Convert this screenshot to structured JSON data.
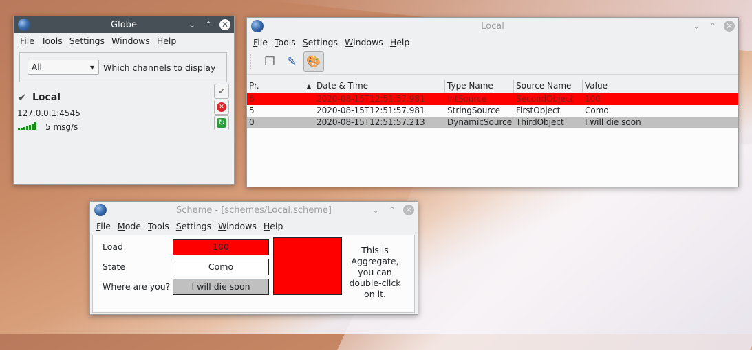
{
  "globe": {
    "title": "Globe",
    "menu": [
      "File",
      "Tools",
      "Settings",
      "Windows",
      "Help"
    ],
    "channel_combo": {
      "value": "All",
      "label": "Which channels to display"
    },
    "source": {
      "name": "Local",
      "address": "127.0.0.1:4545",
      "rate": "5  msg/s"
    }
  },
  "local": {
    "title": "Local",
    "menu": [
      "File",
      "Tools",
      "Settings",
      "Windows",
      "Help"
    ],
    "columns": [
      "Pr.",
      "Date & Time",
      "Type Name",
      "Source Name",
      "Value"
    ],
    "rows": [
      {
        "pr": "6",
        "datetime": "2020-08-15T12:51:57.981",
        "type": "IntSource",
        "source": "SecondObject",
        "value": "100",
        "bg": "#ff0000",
        "fg": "#8b1a1a"
      },
      {
        "pr": "5",
        "datetime": "2020-08-15T12:51:57.981",
        "type": "StringSource",
        "source": "FirstObject",
        "value": "Como",
        "bg": "#fcfcfc",
        "fg": "#232629"
      },
      {
        "pr": "0",
        "datetime": "2020-08-15T12:51:57.213",
        "type": "DynamicSource",
        "source": "ThirdObject",
        "value": "I will die soon",
        "bg": "#c0c0c0",
        "fg": "#232629"
      }
    ]
  },
  "scheme": {
    "title": "Scheme - [schemes/Local.scheme]",
    "menu": [
      "File",
      "Mode",
      "Tools",
      "Settings",
      "Windows",
      "Help"
    ],
    "fields": [
      {
        "label": "Load",
        "value": "100",
        "bg": "#ff0000"
      },
      {
        "label": "State",
        "value": "Como",
        "bg": "#ffffff"
      },
      {
        "label": "Where are you?",
        "value": "I will die soon",
        "bg": "#c0c0c0"
      }
    ],
    "aggregate_color": "#ff0000",
    "aggregate_text": "This is Aggregate, you can double-click on it."
  },
  "colors": {
    "accent": "#3daee9",
    "signal": "#1d8a1d"
  }
}
